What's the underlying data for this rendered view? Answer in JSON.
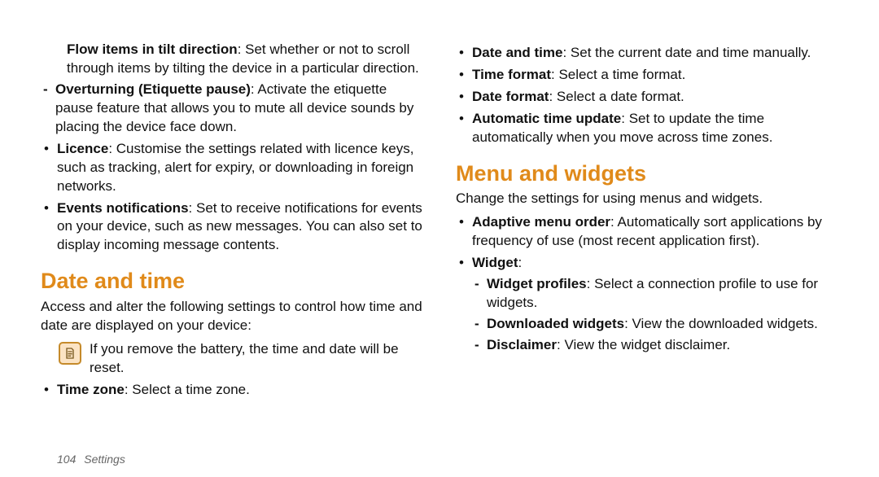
{
  "left": {
    "flow_bold": "Flow items in tilt direction",
    "flow_text": ": Set whether or not to scroll through items by tilting the device in a particular direction.",
    "overturn_bold": "Overturning (Etiquette pause)",
    "overturn_text": ": Activate the etiquette pause feature that allows you to mute all device sounds by placing the device face down.",
    "licence_bold": "Licence",
    "licence_text": ": Customise the settings related with licence keys, such as tracking, alert for expiry, or downloading in foreign networks.",
    "events_bold": "Events notifications",
    "events_text": ": Set to receive notifications for events on your device, such as new messages. You can also set to display incoming message contents.",
    "heading_datetime": "Date and time",
    "datetime_intro": "Access and alter the following settings to control how time and date are displayed on your device:",
    "note_text": "If you remove the battery, the time and date will be reset.",
    "timezone_bold": "Time zone",
    "timezone_text": ": Select a time zone."
  },
  "right": {
    "dt_bold": "Date and time",
    "dt_text": ": Set the current date and time manually.",
    "tf_bold": "Time format",
    "tf_text": ": Select a time format.",
    "df_bold": "Date format",
    "df_text": ": Select a date format.",
    "atu_bold": "Automatic time update",
    "atu_text": ": Set to update the time automatically when you move across time zones.",
    "heading_menu": "Menu and widgets",
    "menu_intro": "Change the settings for using menus and widgets.",
    "amo_bold": "Adaptive menu order",
    "amo_text": ": Automatically sort applications by frequency of use (most recent application first).",
    "widget_bold": "Widget",
    "widget_colon": ":",
    "wp_bold": "Widget profiles",
    "wp_text": ": Select a connection profile to use for widgets.",
    "dw_bold": "Downloaded widgets",
    "dw_text": ": View the downloaded widgets.",
    "disc_bold": "Disclaimer",
    "disc_text": ": View the widget disclaimer."
  },
  "footer": {
    "page_number": "104",
    "section": "Settings"
  }
}
